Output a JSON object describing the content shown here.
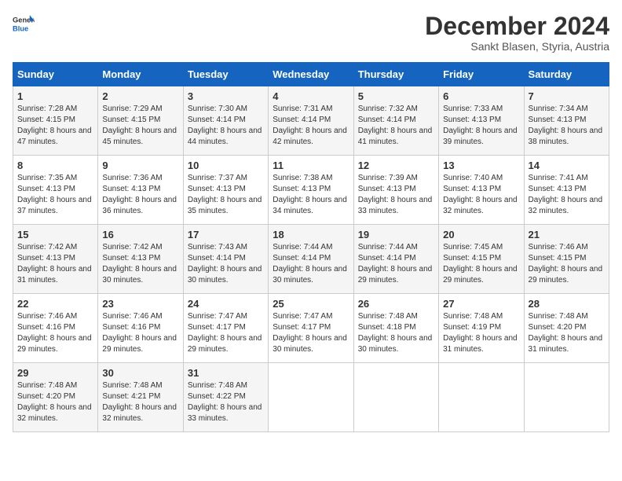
{
  "header": {
    "logo_line1": "General",
    "logo_line2": "Blue",
    "month": "December 2024",
    "location": "Sankt Blasen, Styria, Austria"
  },
  "days_of_week": [
    "Sunday",
    "Monday",
    "Tuesday",
    "Wednesday",
    "Thursday",
    "Friday",
    "Saturday"
  ],
  "weeks": [
    [
      {
        "day": 1,
        "rise": "7:28 AM",
        "set": "4:15 PM",
        "daylight": "8 hours and 47 minutes."
      },
      {
        "day": 2,
        "rise": "7:29 AM",
        "set": "4:15 PM",
        "daylight": "8 hours and 45 minutes."
      },
      {
        "day": 3,
        "rise": "7:30 AM",
        "set": "4:14 PM",
        "daylight": "8 hours and 44 minutes."
      },
      {
        "day": 4,
        "rise": "7:31 AM",
        "set": "4:14 PM",
        "daylight": "8 hours and 42 minutes."
      },
      {
        "day": 5,
        "rise": "7:32 AM",
        "set": "4:14 PM",
        "daylight": "8 hours and 41 minutes."
      },
      {
        "day": 6,
        "rise": "7:33 AM",
        "set": "4:13 PM",
        "daylight": "8 hours and 39 minutes."
      },
      {
        "day": 7,
        "rise": "7:34 AM",
        "set": "4:13 PM",
        "daylight": "8 hours and 38 minutes."
      }
    ],
    [
      {
        "day": 8,
        "rise": "7:35 AM",
        "set": "4:13 PM",
        "daylight": "8 hours and 37 minutes."
      },
      {
        "day": 9,
        "rise": "7:36 AM",
        "set": "4:13 PM",
        "daylight": "8 hours and 36 minutes."
      },
      {
        "day": 10,
        "rise": "7:37 AM",
        "set": "4:13 PM",
        "daylight": "8 hours and 35 minutes."
      },
      {
        "day": 11,
        "rise": "7:38 AM",
        "set": "4:13 PM",
        "daylight": "8 hours and 34 minutes."
      },
      {
        "day": 12,
        "rise": "7:39 AM",
        "set": "4:13 PM",
        "daylight": "8 hours and 33 minutes."
      },
      {
        "day": 13,
        "rise": "7:40 AM",
        "set": "4:13 PM",
        "daylight": "8 hours and 32 minutes."
      },
      {
        "day": 14,
        "rise": "7:41 AM",
        "set": "4:13 PM",
        "daylight": "8 hours and 32 minutes."
      }
    ],
    [
      {
        "day": 15,
        "rise": "7:42 AM",
        "set": "4:13 PM",
        "daylight": "8 hours and 31 minutes."
      },
      {
        "day": 16,
        "rise": "7:42 AM",
        "set": "4:13 PM",
        "daylight": "8 hours and 30 minutes."
      },
      {
        "day": 17,
        "rise": "7:43 AM",
        "set": "4:14 PM",
        "daylight": "8 hours and 30 minutes."
      },
      {
        "day": 18,
        "rise": "7:44 AM",
        "set": "4:14 PM",
        "daylight": "8 hours and 30 minutes."
      },
      {
        "day": 19,
        "rise": "7:44 AM",
        "set": "4:14 PM",
        "daylight": "8 hours and 29 minutes."
      },
      {
        "day": 20,
        "rise": "7:45 AM",
        "set": "4:15 PM",
        "daylight": "8 hours and 29 minutes."
      },
      {
        "day": 21,
        "rise": "7:46 AM",
        "set": "4:15 PM",
        "daylight": "8 hours and 29 minutes."
      }
    ],
    [
      {
        "day": 22,
        "rise": "7:46 AM",
        "set": "4:16 PM",
        "daylight": "8 hours and 29 minutes."
      },
      {
        "day": 23,
        "rise": "7:46 AM",
        "set": "4:16 PM",
        "daylight": "8 hours and 29 minutes."
      },
      {
        "day": 24,
        "rise": "7:47 AM",
        "set": "4:17 PM",
        "daylight": "8 hours and 29 minutes."
      },
      {
        "day": 25,
        "rise": "7:47 AM",
        "set": "4:17 PM",
        "daylight": "8 hours and 30 minutes."
      },
      {
        "day": 26,
        "rise": "7:48 AM",
        "set": "4:18 PM",
        "daylight": "8 hours and 30 minutes."
      },
      {
        "day": 27,
        "rise": "7:48 AM",
        "set": "4:19 PM",
        "daylight": "8 hours and 31 minutes."
      },
      {
        "day": 28,
        "rise": "7:48 AM",
        "set": "4:20 PM",
        "daylight": "8 hours and 31 minutes."
      }
    ],
    [
      {
        "day": 29,
        "rise": "7:48 AM",
        "set": "4:20 PM",
        "daylight": "8 hours and 32 minutes."
      },
      {
        "day": 30,
        "rise": "7:48 AM",
        "set": "4:21 PM",
        "daylight": "8 hours and 32 minutes."
      },
      {
        "day": 31,
        "rise": "7:48 AM",
        "set": "4:22 PM",
        "daylight": "8 hours and 33 minutes."
      },
      null,
      null,
      null,
      null
    ]
  ],
  "labels": {
    "sunrise": "Sunrise:",
    "sunset": "Sunset:",
    "daylight": "Daylight:"
  }
}
